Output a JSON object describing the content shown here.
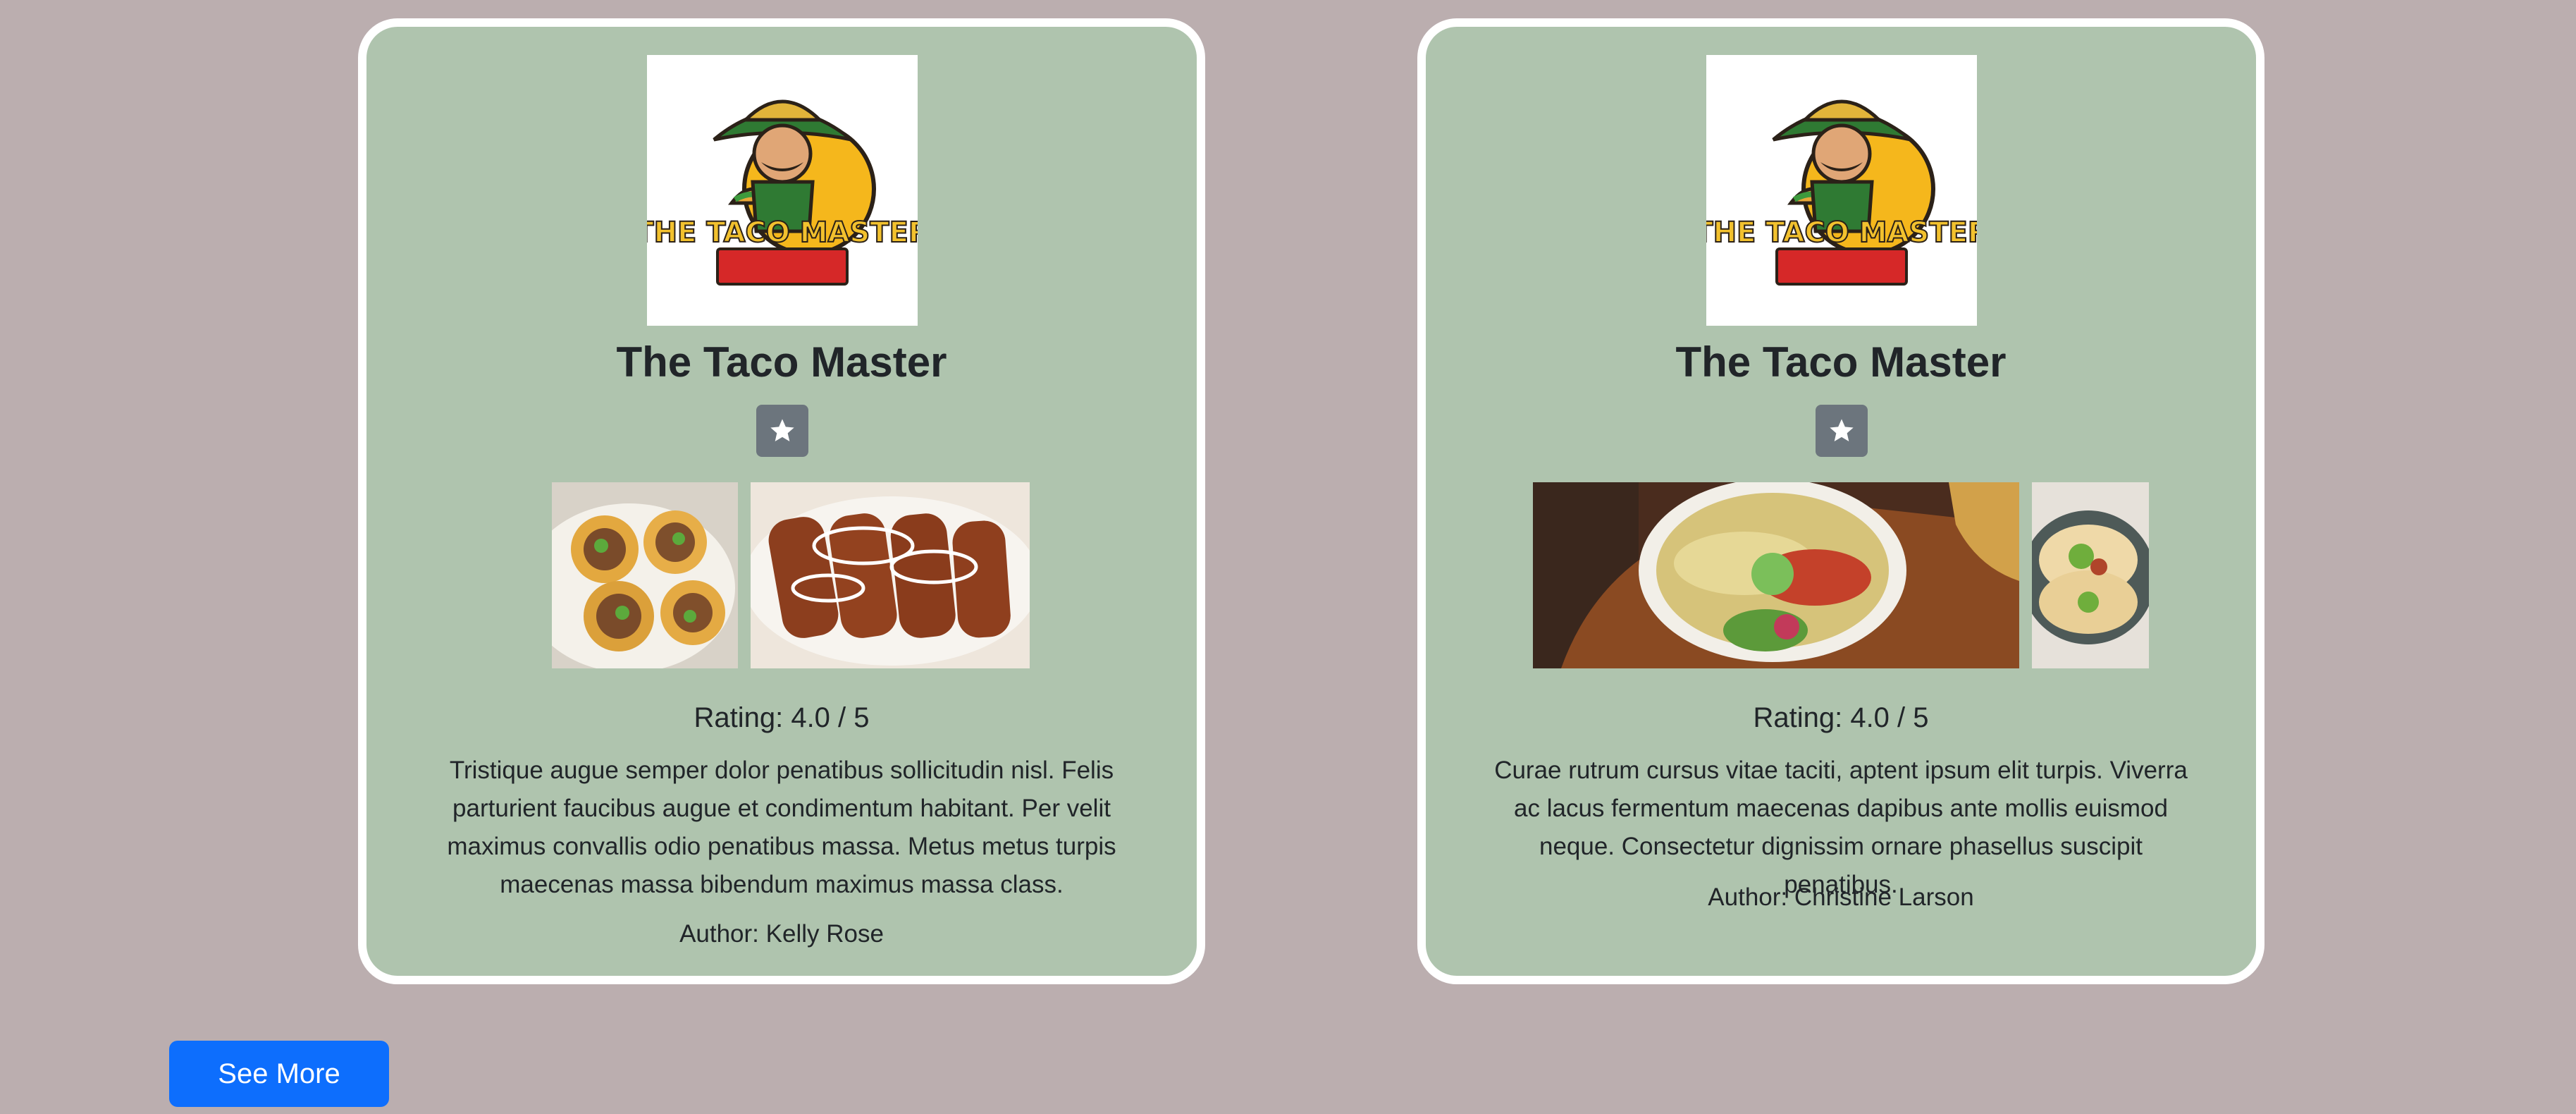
{
  "colors": {
    "page_background": "#bbaeaf",
    "card_background": "#afc4ae",
    "card_border": "#ffffff",
    "favorite_button": "#6c757d",
    "primary_button": "#0d6efd"
  },
  "cards": [
    {
      "logo_icon": "taco-master-logo",
      "logo_text": "THE TACO MASTER",
      "title": "The Taco Master",
      "favorite_icon": "star-icon",
      "photos": [
        "tostadas-photo",
        "enchiladas-photo"
      ],
      "rating": "Rating: 4.0 / 5",
      "description": "Tristique augue semper dolor penatibus sollicitudin nisl. Felis parturient faucibus augue et condimentum habitant. Per velit maximus convallis odio penatibus massa. Metus metus turpis maecenas massa bibendum maximus massa class.",
      "author": "Author: Kelly Rose"
    },
    {
      "logo_icon": "taco-master-logo",
      "logo_text": "THE TACO MASTER",
      "title": "The Taco Master",
      "favorite_icon": "star-icon",
      "photos": [
        "enchilada-plate-photo",
        "tacos-photo"
      ],
      "rating": "Rating: 4.0 / 5",
      "description": "Curae rutrum cursus vitae taciti, aptent ipsum elit turpis. Viverra ac lacus fermentum maecenas dapibus ante mollis euismod neque. Consectetur dignissim ornare phasellus suscipit penatibus.",
      "author": "Author: Christine Larson"
    }
  ],
  "see_more_label": "See More"
}
